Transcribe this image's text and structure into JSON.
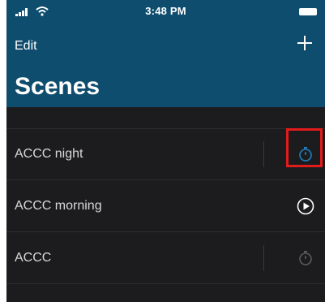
{
  "status_bar": {
    "time": "3:48 PM"
  },
  "nav": {
    "edit_label": "Edit",
    "add_icon": "plus-icon"
  },
  "page": {
    "title": "Scenes"
  },
  "scenes": [
    {
      "name": "ACCC night",
      "action_icon": "timer-icon",
      "icon_color": "#1f7fbf"
    },
    {
      "name": "ACCC morning",
      "action_icon": "play-circle-icon",
      "icon_color": "#ffffff"
    },
    {
      "name": "ACCC",
      "action_icon": "timer-icon",
      "icon_color": "#5a5a5e"
    }
  ],
  "colors": {
    "header_bg": "#0f4d6e",
    "list_bg": "#1c1c1e",
    "highlight": "#e21b1b"
  }
}
